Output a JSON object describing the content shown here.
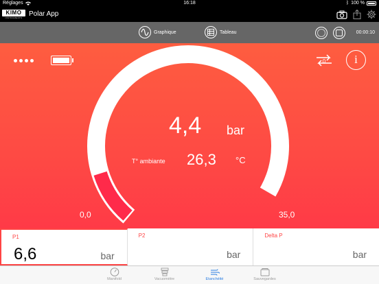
{
  "status_bar": {
    "back_app": "Réglages",
    "time": "16:18",
    "battery_text": "100 %"
  },
  "app_bar": {
    "logo_text": "KIMO",
    "logo_subtext": "INSTRUMENTS",
    "title": "Polar App"
  },
  "toolbar": {
    "graph_label": "Graphique",
    "table_label": "Tableau",
    "timer": "00:00:10"
  },
  "gauge": {
    "swap_badge": "0",
    "info_glyph": "i",
    "main_value": "4,4",
    "main_unit": "bar",
    "ambient_label": "T° ambiante",
    "ambient_value": "26,3",
    "ambient_unit": "°C",
    "min_label": "0,0",
    "max_label": "35,0",
    "range_min": 0.0,
    "range_max": 35.0,
    "current_value": 4.4,
    "arc_color": "#ffffff",
    "fill_color": "#ff2a4a"
  },
  "cards": [
    {
      "label": "P1",
      "value": "6,6",
      "unit": "bar"
    },
    {
      "label": "P2",
      "value": "",
      "unit": "bar"
    },
    {
      "label": "Delta P",
      "value": "",
      "unit": "bar"
    }
  ],
  "tabs": [
    {
      "label": "Manifold",
      "icon": "gauge-icon"
    },
    {
      "label": "Vacuomètre",
      "icon": "vacuum-icon"
    },
    {
      "label": "Etanchéité",
      "icon": "wind-icon"
    },
    {
      "label": "Sauvegardes",
      "icon": "folder-icon"
    }
  ],
  "colors": {
    "accent": "#ff4444",
    "active_tab": "#2a7de1",
    "toolbar_bg": "#666666"
  }
}
